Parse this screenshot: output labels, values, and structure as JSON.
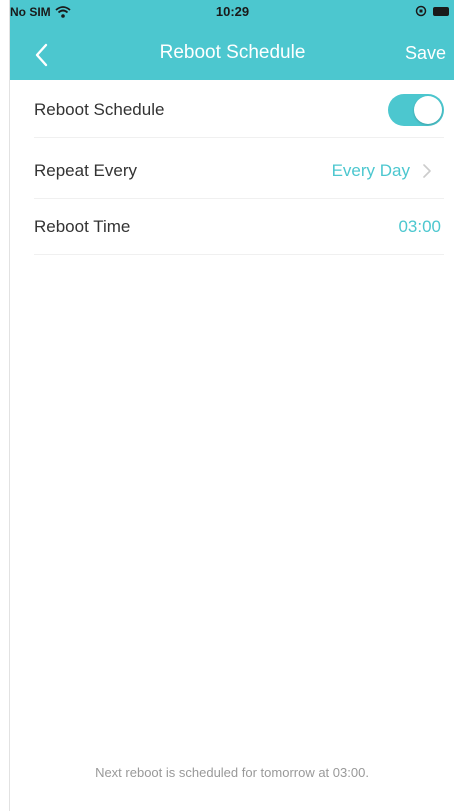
{
  "statusbar": {
    "carrier": "No SIM",
    "time": "10:29"
  },
  "nav": {
    "title": "Reboot Schedule",
    "save_label": "Save"
  },
  "settings": {
    "schedule": {
      "label": "Reboot Schedule",
      "enabled": true
    },
    "repeat": {
      "label": "Repeat Every",
      "value": "Every Day"
    },
    "time": {
      "label": "Reboot Time",
      "value": "03:00"
    }
  },
  "footer": {
    "note": "Next reboot is scheduled for tomorrow at 03:00."
  },
  "colors": {
    "accent": "#4cc7cf",
    "text": "#333333",
    "muted": "#999999"
  }
}
